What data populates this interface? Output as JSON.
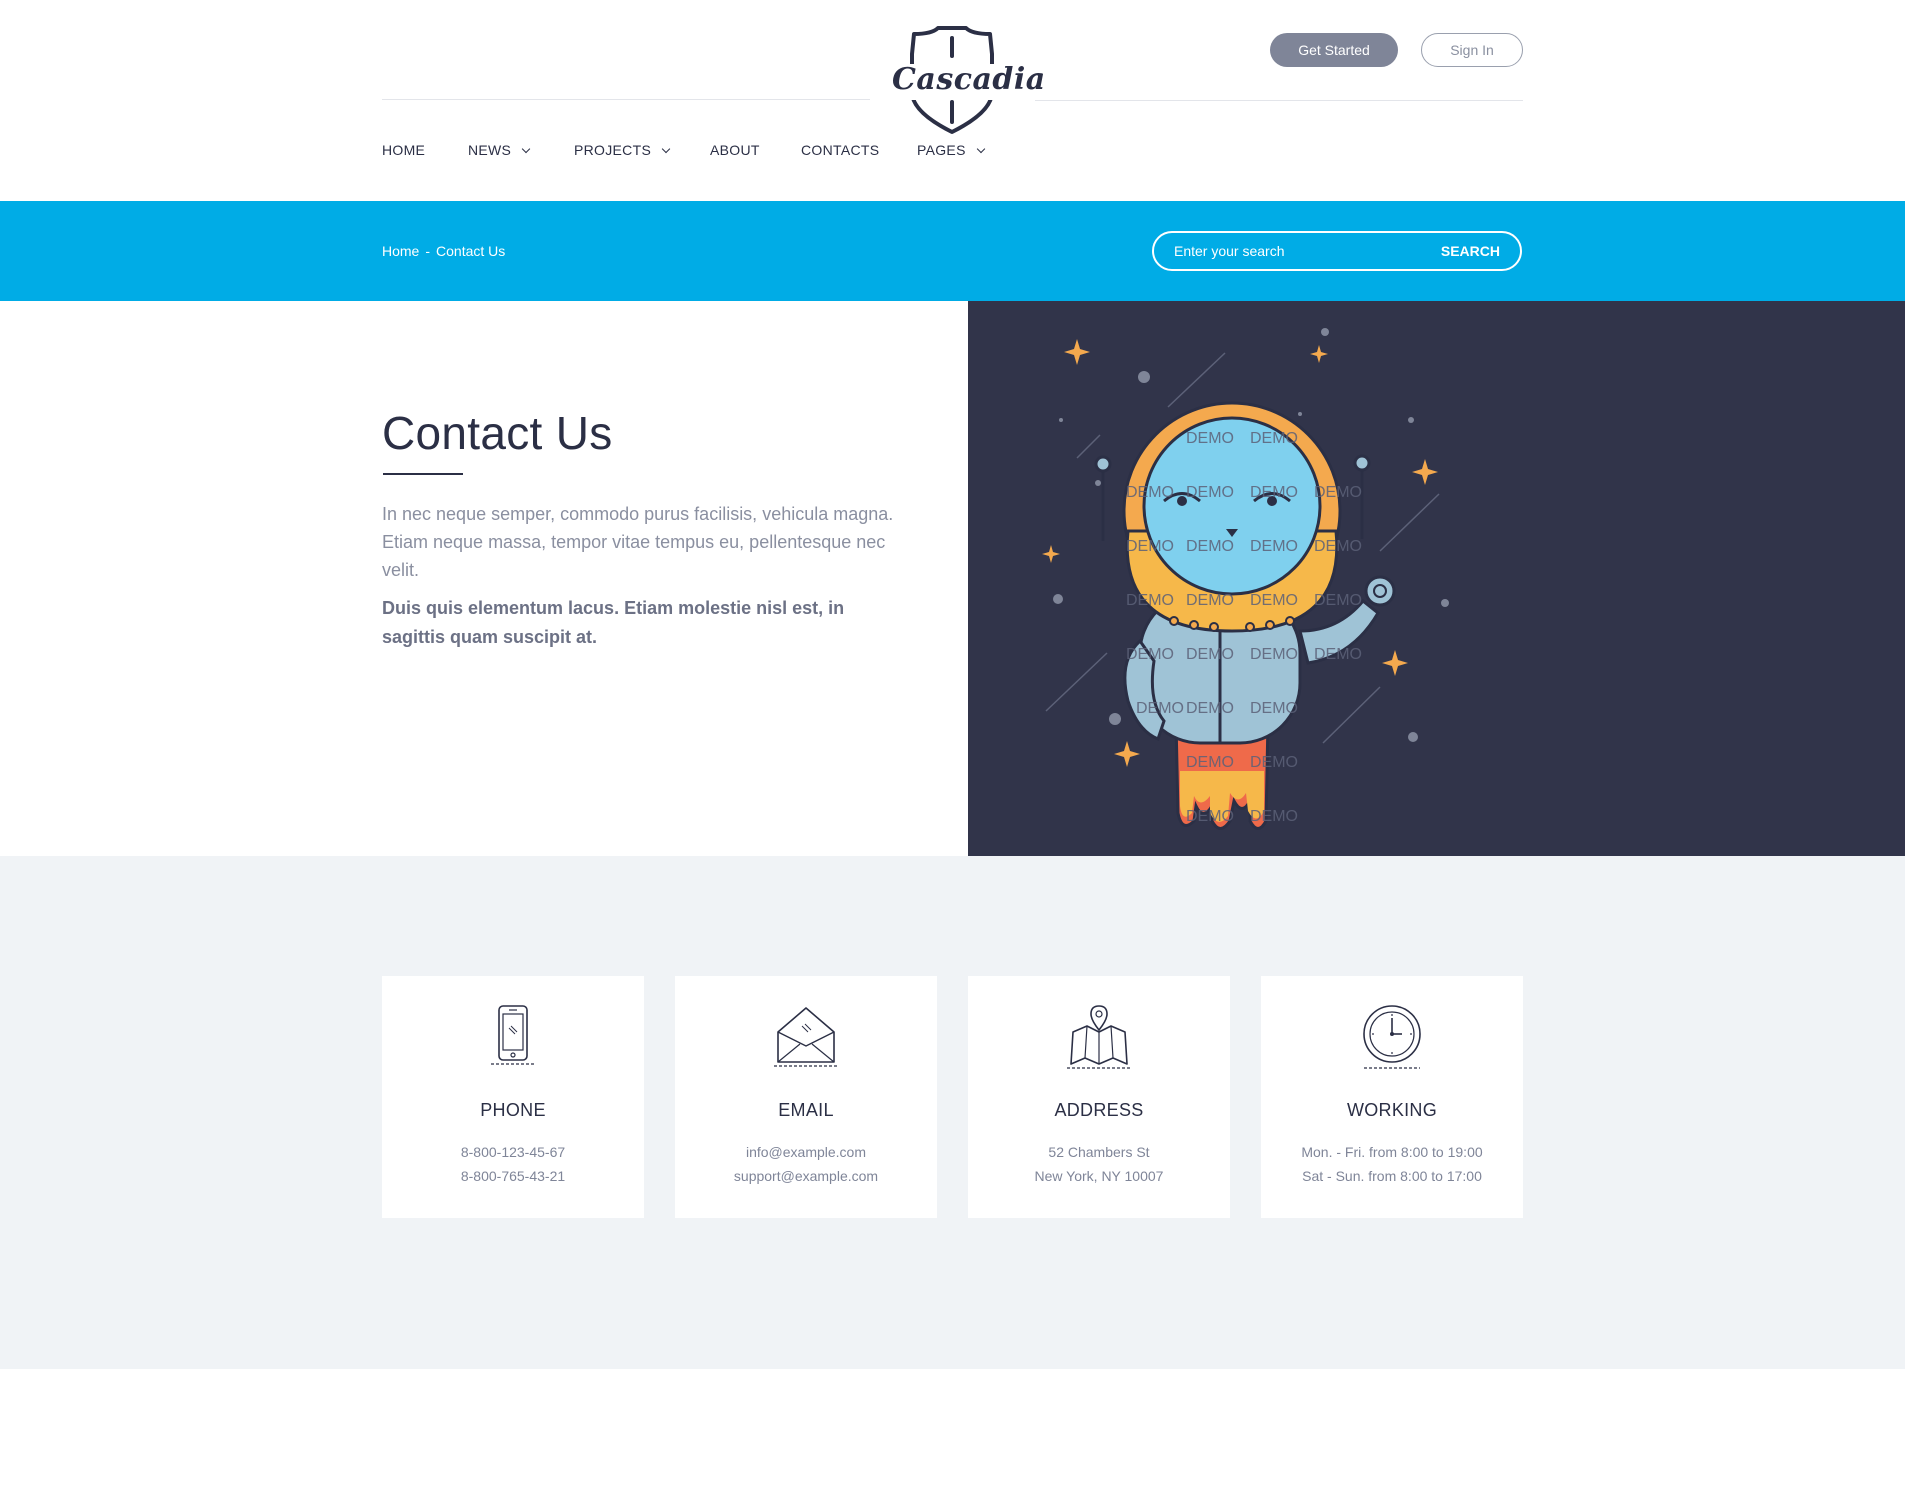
{
  "brand": {
    "logo_text": "Cascadia"
  },
  "header": {
    "get_started_label": "Get Started",
    "sign_in_label": "Sign In"
  },
  "nav": {
    "items": [
      {
        "label": "HOME",
        "has_dropdown": false
      },
      {
        "label": "NEWS",
        "has_dropdown": true
      },
      {
        "label": "PROJECTS",
        "has_dropdown": true
      },
      {
        "label": "ABOUT",
        "has_dropdown": false
      },
      {
        "label": "CONTACTS",
        "has_dropdown": false
      },
      {
        "label": "PAGES",
        "has_dropdown": true
      }
    ]
  },
  "breadcrumb": {
    "home": "Home",
    "separator": "-",
    "current": "Contact Us"
  },
  "search": {
    "placeholder": "Enter your search",
    "button_label": "SEARCH"
  },
  "hero": {
    "title": "Contact Us",
    "paragraph": "In nec neque semper, commodo purus facilisis, vehicula magna. Etiam neque massa, tempor vitae tempus eu, pellentesque nec velit.",
    "paragraph_bold": "Duis quis elementum lacus. Etiam molestie nisl est, in sagittis quam suscipit at.",
    "illustration": "astronaut-illustration",
    "watermark": "DEMO"
  },
  "contact_cards": [
    {
      "icon": "phone-icon",
      "title": "PHONE",
      "line1": "8-800-123-45-67",
      "line2": "8-800-765-43-21"
    },
    {
      "icon": "envelope-icon",
      "title": "EMAIL",
      "line1": "info@example.com",
      "line2": "support@example.com"
    },
    {
      "icon": "map-pin-icon",
      "title": "ADDRESS",
      "line1": "52 Chambers St",
      "line2": "New York, NY 10007"
    },
    {
      "icon": "clock-icon",
      "title": "WORKING",
      "line1": "Mon. - Fri. from 8:00 to 19:00",
      "line2": "Sat - Sun. from 8:00 to 17:00"
    }
  ],
  "colors": {
    "accent_blue": "#00ace6",
    "dark_navy": "#31344a",
    "text_dark": "#2b2f45",
    "muted_bg": "#f0f3f6",
    "button_grey": "#7f8598"
  }
}
